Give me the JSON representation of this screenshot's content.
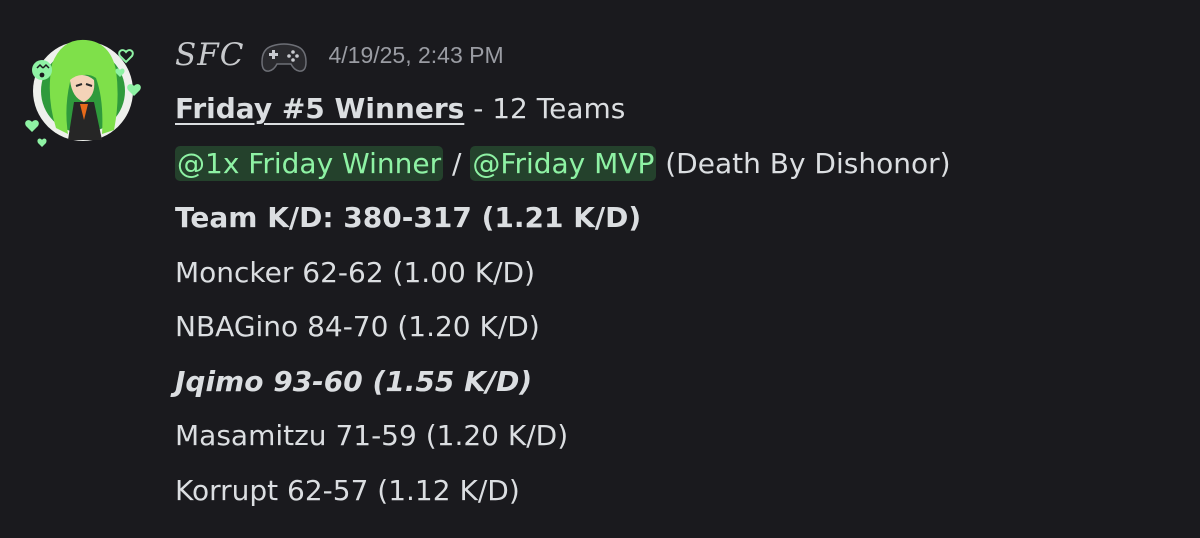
{
  "author": {
    "username": "SFC",
    "badge_icon": "game-controller-icon",
    "timestamp": "4/19/25, 2:43 PM"
  },
  "message": {
    "title": "Friday #5 Winners",
    "title_suffix": " - 12 Teams",
    "mention_1": "@1x Friday Winner",
    "separator": " / ",
    "mention_2": "@Friday MVP",
    "mvp_note": " (Death By Dishonor)",
    "team_kd": "Team K/D: 380-317 (1.21 K/D)",
    "players": [
      "Moncker 62-62 (1.00 K/D)",
      "NBAGino 84-70 (1.20 K/D)",
      "Jqimo 93-60 (1.55 K/D)",
      "Masamitzu 71-59 (1.20 K/D)",
      "Korrupt 62-57 (1.12 K/D)"
    ]
  },
  "colors": {
    "background": "#1a1a1e",
    "text": "#dbdee1",
    "mention_bg": "#24412c",
    "mention_text": "#8ef2a4",
    "timestamp": "#9a9ca3"
  }
}
